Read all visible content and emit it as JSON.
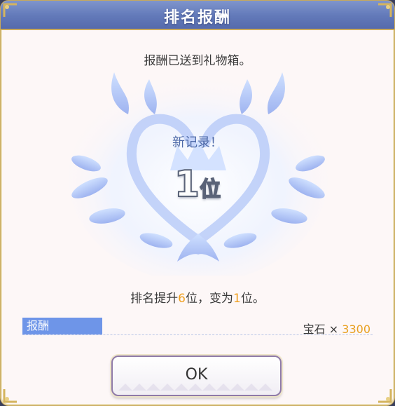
{
  "dialog": {
    "title": "排名报酬",
    "message": "报酬已送到礼物箱。",
    "crest": {
      "heading": "新记录！",
      "rank_number": "1",
      "rank_unit": "位"
    },
    "rank_change": {
      "prefix": "排名提升",
      "up_count": "6",
      "middle": "位，变为",
      "new_rank": "1",
      "suffix": "位。"
    },
    "reward": {
      "label": "报酬",
      "item": "宝石",
      "times": "×",
      "count": "3300"
    },
    "ok_label": "OK"
  },
  "colors": {
    "title_bar": "#6279b9",
    "gold_frame": "#c9a95a",
    "highlight": "#f0a020",
    "reward_label_bg": "#6e95e8",
    "crest_blue": "#a9c6ff"
  }
}
